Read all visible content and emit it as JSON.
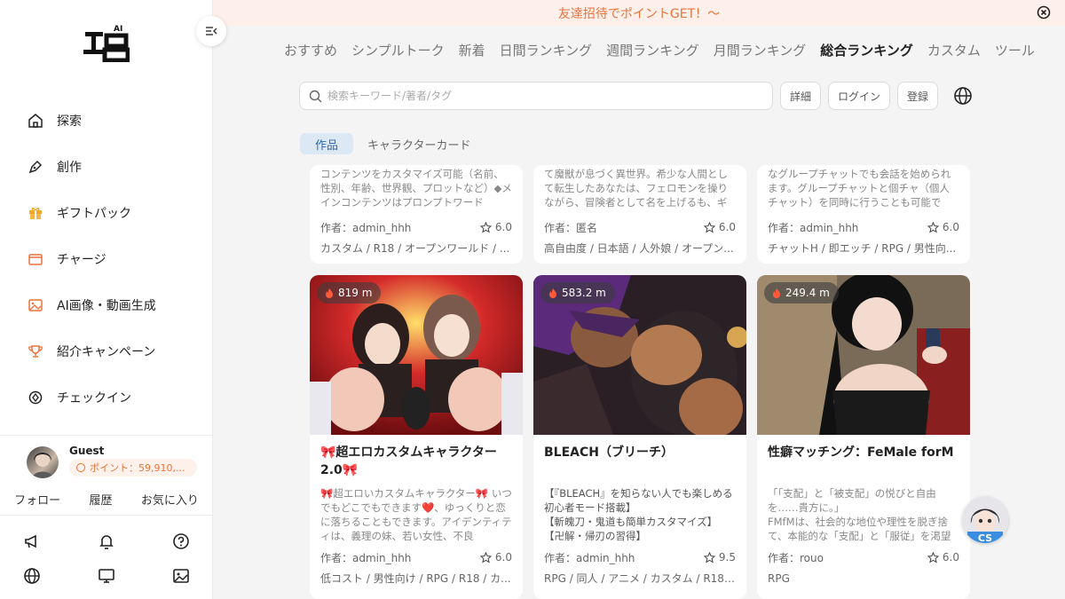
{
  "banner": {
    "text": "友達招待でポイントGET！～"
  },
  "sidebar": {
    "nav": [
      {
        "label": "探索",
        "icon": "home-icon"
      },
      {
        "label": "創作",
        "icon": "pen-icon"
      },
      {
        "label": "ギフトパック",
        "icon": "gift-icon"
      },
      {
        "label": "チャージ",
        "icon": "wallet-icon"
      },
      {
        "label": "AI画像・動画生成",
        "icon": "image-icon"
      },
      {
        "label": "紹介キャンペーン",
        "icon": "trophy-icon"
      },
      {
        "label": "チェックイン",
        "icon": "checkin-icon"
      }
    ],
    "user": {
      "name": "Guest",
      "points": "ポイント：59,910,..."
    },
    "links": [
      "フォロー",
      "履歴",
      "お気に入り"
    ]
  },
  "categories": [
    "おすすめ",
    "シンプルトーク",
    "新着",
    "日間ランキング",
    "週間ランキング",
    "月間ランキング",
    "総合ランキング",
    "カスタム",
    "ツール"
  ],
  "active_category": "総合ランキング",
  "search": {
    "placeholder": "検索キーワード/著者/タグ"
  },
  "buttons": {
    "detail": "詳細",
    "login": "ログイン",
    "register": "登録"
  },
  "subtabs": {
    "works": "作品",
    "character_cards": "キャラクターカード"
  },
  "top_cards": [
    {
      "desc": "コンテンツをカスタマイズ可能（名前、性別、年齢、世界観、プロットなど）◆メインコンテンツはプロンプトワード",
      "author": "作者：admin_hhh",
      "rating": "6.0",
      "tags": "カスタム / R18 / オープンワールド / ..."
    },
    {
      "desc": "て魔獣が息づく異世界。希少な人間として転生したあなたは、フェロモンを操りながら、冒険者として名を上げるも、ギ",
      "author": "作者：匿名",
      "rating": "6.0",
      "tags": "高自由度 / 日本語 / 人外娘 / オープン..."
    },
    {
      "desc": "なグループチャットでも会話を始められます。グループチャットと個チャ（個人チャット）を同時に行うことも可能で",
      "author": "作者：admin_hhh",
      "rating": "6.0",
      "tags": "チャットH / 即エッチ / RPG / 男性向..."
    }
  ],
  "cards": [
    {
      "views": "819 m",
      "title": "🎀超エロカスタムキャラクター2.0🎀",
      "desc": "🎀超エロいカスタムキャラクター🎀 いつでもどこでもできます❤️、ゆっくりと恋に落ちることもできます。アイデンティティは、義理の妹、若い女性、不良",
      "author": "作者：admin_hhh",
      "rating": "6.0",
      "tags": "低コスト / 男性向け / RPG / R18 / カ..."
    },
    {
      "views": "583.2 m",
      "title": "BLEACH（ブリーチ）",
      "desc": "【『BLEACH』を知らない人でも楽しめる初心者モード搭載】\n【斬魄刀・鬼道も簡単カスタマイズ】\n【卍解・帰刃の習得】",
      "author": "作者：admin_hhh",
      "rating": "9.5",
      "tags": "RPG / 同人 / アニメ / カスタム / R18 /..."
    },
    {
      "views": "249.4 m",
      "title": "性癖マッチング：FeMale forM",
      "desc": "「「支配」と「被支配」の悦びと自由を……貴方に。」\nFMfMは、社会的な地位や理性を脱ぎ捨て、本能的な「支配」と「服従」を渇望",
      "author": "作者：rouo",
      "rating": "6.0",
      "tags": "RPG"
    }
  ],
  "cs_label": "CS"
}
